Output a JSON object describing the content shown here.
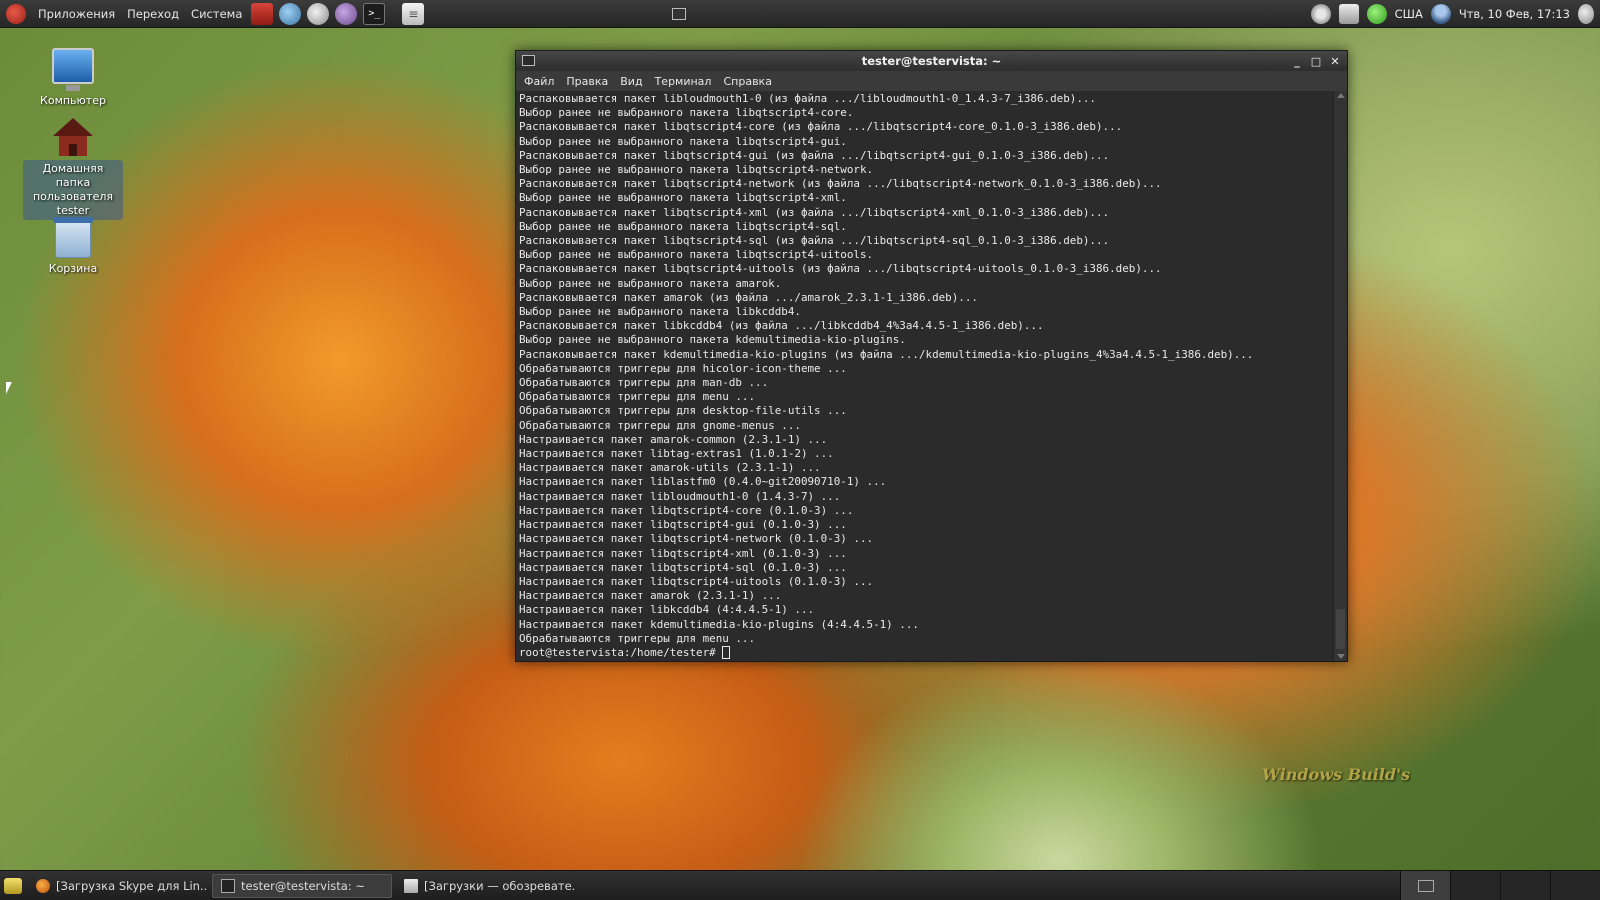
{
  "top_panel": {
    "menus": [
      "Приложения",
      "Переход",
      "Система"
    ],
    "launchers": [
      "presentation-icon",
      "browser-icon",
      "mail-icon",
      "im-icon",
      "terminal-icon",
      "notes-icon"
    ],
    "tray": {
      "keyboard_layout": "США",
      "datetime": "Чтв, 10 Фев, 17:13"
    }
  },
  "desktop": {
    "icons": [
      {
        "label": "Компьютер",
        "icon": "computer-icon"
      },
      {
        "label": "Домашняя папка пользователя tester",
        "icon": "home-folder-icon"
      },
      {
        "label": "Корзина",
        "icon": "trash-icon"
      }
    ],
    "watermark": "Windows Build's"
  },
  "terminal": {
    "title": "tester@testervista: ~",
    "menu": [
      "Файл",
      "Правка",
      "Вид",
      "Терминал",
      "Справка"
    ],
    "lines": [
      "Распаковывается пакет libloudmouth1-0 (из файла .../libloudmouth1-0_1.4.3-7_i386.deb)...",
      "Выбор ранее не выбранного пакета libqtscript4-core.",
      "Распаковывается пакет libqtscript4-core (из файла .../libqtscript4-core_0.1.0-3_i386.deb)...",
      "Выбор ранее не выбранного пакета libqtscript4-gui.",
      "Распаковывается пакет libqtscript4-gui (из файла .../libqtscript4-gui_0.1.0-3_i386.deb)...",
      "Выбор ранее не выбранного пакета libqtscript4-network.",
      "Распаковывается пакет libqtscript4-network (из файла .../libqtscript4-network_0.1.0-3_i386.deb)...",
      "Выбор ранее не выбранного пакета libqtscript4-xml.",
      "Распаковывается пакет libqtscript4-xml (из файла .../libqtscript4-xml_0.1.0-3_i386.deb)...",
      "Выбор ранее не выбранного пакета libqtscript4-sql.",
      "Распаковывается пакет libqtscript4-sql (из файла .../libqtscript4-sql_0.1.0-3_i386.deb)...",
      "Выбор ранее не выбранного пакета libqtscript4-uitools.",
      "Распаковывается пакет libqtscript4-uitools (из файла .../libqtscript4-uitools_0.1.0-3_i386.deb)...",
      "Выбор ранее не выбранного пакета amarok.",
      "Распаковывается пакет amarok (из файла .../amarok_2.3.1-1_i386.deb)...",
      "Выбор ранее не выбранного пакета libkcddb4.",
      "Распаковывается пакет libkcddb4 (из файла .../libkcddb4_4%3a4.4.5-1_i386.deb)...",
      "Выбор ранее не выбранного пакета kdemultimedia-kio-plugins.",
      "Распаковывается пакет kdemultimedia-kio-plugins (из файла .../kdemultimedia-kio-plugins_4%3a4.4.5-1_i386.deb)...",
      "Обрабатываются триггеры для hicolor-icon-theme ...",
      "Обрабатываются триггеры для man-db ...",
      "Обрабатываются триггеры для menu ...",
      "Обрабатываются триггеры для desktop-file-utils ...",
      "Обрабатываются триггеры для gnome-menus ...",
      "Настраивается пакет amarok-common (2.3.1-1) ...",
      "Настраивается пакет libtag-extras1 (1.0.1-2) ...",
      "Настраивается пакет amarok-utils (2.3.1-1) ...",
      "Настраивается пакет liblastfm0 (0.4.0~git20090710-1) ...",
      "Настраивается пакет libloudmouth1-0 (1.4.3-7) ...",
      "Настраивается пакет libqtscript4-core (0.1.0-3) ...",
      "Настраивается пакет libqtscript4-gui (0.1.0-3) ...",
      "Настраивается пакет libqtscript4-network (0.1.0-3) ...",
      "Настраивается пакет libqtscript4-xml (0.1.0-3) ...",
      "Настраивается пакет libqtscript4-sql (0.1.0-3) ...",
      "Настраивается пакет libqtscript4-uitools (0.1.0-3) ...",
      "Настраивается пакет amarok (2.3.1-1) ...",
      "Настраивается пакет libkcddb4 (4:4.4.5-1) ...",
      "Настраивается пакет kdemultimedia-kio-plugins (4:4.4.5-1) ...",
      "Обрабатываются триггеры для menu ..."
    ],
    "prompt": "root@testervista:/home/tester#"
  },
  "taskbar": {
    "tasks": [
      {
        "label": "[Загрузка Skype для Lin...",
        "icon": "firefox-icon",
        "active": false
      },
      {
        "label": "tester@testervista: ~",
        "icon": "terminal-icon",
        "active": true
      },
      {
        "label": "[Загрузки — обозревате...",
        "icon": "file-manager-icon",
        "active": false
      }
    ],
    "workspace_count": 4,
    "current_workspace": 1
  }
}
